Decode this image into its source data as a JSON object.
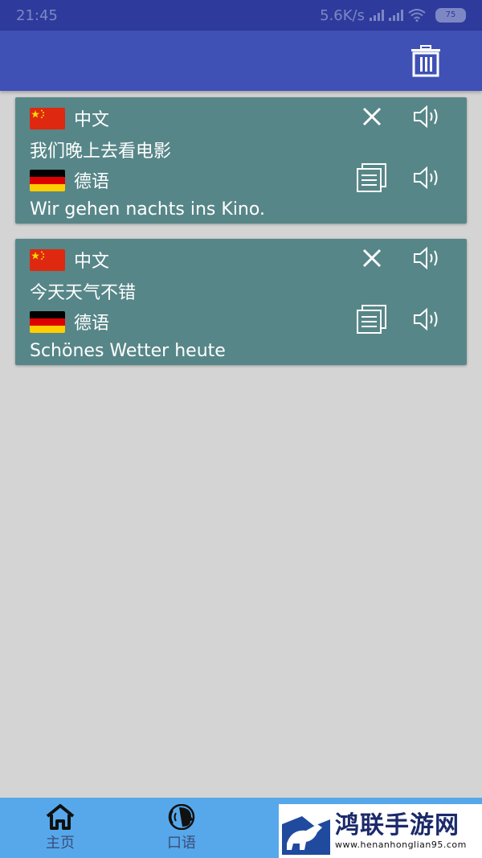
{
  "status_bar": {
    "time": "21:45",
    "net_speed": "5.6K/s",
    "battery": "75"
  },
  "app_bar": {
    "delete_icon": "trash-icon"
  },
  "cards": [
    {
      "source_lang": "中文",
      "source_text": "我们晚上去看电影",
      "target_lang": "德语",
      "target_text": "Wir gehen nachts ins Kino."
    },
    {
      "source_lang": "中文",
      "source_text": "今天天气不错",
      "target_lang": "德语",
      "target_text": "Schönes Wetter heute"
    }
  ],
  "bottom_nav": {
    "items": [
      {
        "label": "主页",
        "icon": "home-icon"
      },
      {
        "label": "口语",
        "icon": "speech-icon"
      }
    ]
  },
  "watermark": {
    "title": "鸿联手游网",
    "url": "www.henanhonglian95.com"
  },
  "colors": {
    "status_bar": "#2e3b9c",
    "app_bar": "#3f51b5",
    "card": "#578688",
    "background": "#d4d4d4",
    "bottom_nav": "#56a8ea"
  }
}
